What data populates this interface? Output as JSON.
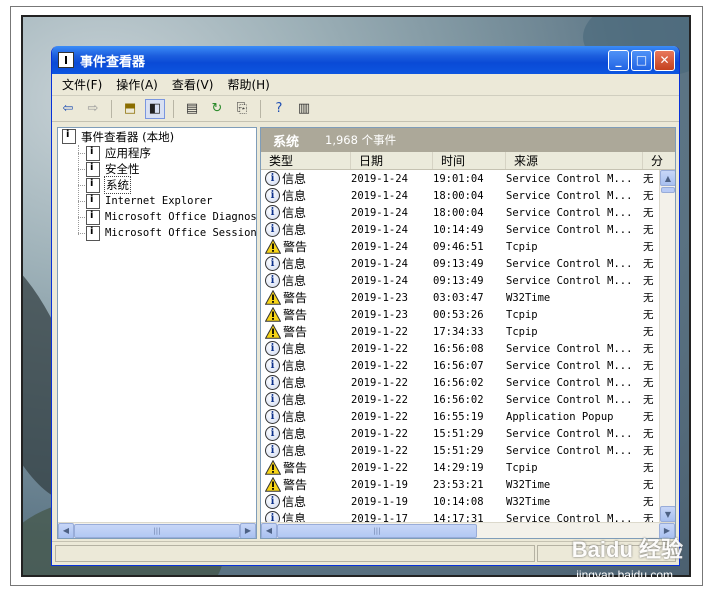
{
  "window": {
    "title": "事件查看器",
    "menu": [
      "文件(F)",
      "操作(A)",
      "查看(V)",
      "帮助(H)"
    ]
  },
  "tree": {
    "root": "事件查看器 (本地)",
    "items": [
      "应用程序",
      "安全性",
      "系统",
      "Internet Explorer",
      "Microsoft Office Diagnostics",
      "Microsoft Office Sessions"
    ],
    "selected_index": 2
  },
  "list": {
    "header_name": "系统",
    "header_count": "1,968 个事件",
    "columns": [
      "类型",
      "日期",
      "时间",
      "来源",
      "分"
    ],
    "rows": [
      {
        "type": "info",
        "label": "信息",
        "date": "2019-1-24",
        "time": "19:01:04",
        "source": "Service Control M...",
        "cat": "无"
      },
      {
        "type": "info",
        "label": "信息",
        "date": "2019-1-24",
        "time": "18:00:04",
        "source": "Service Control M...",
        "cat": "无"
      },
      {
        "type": "info",
        "label": "信息",
        "date": "2019-1-24",
        "time": "18:00:04",
        "source": "Service Control M...",
        "cat": "无"
      },
      {
        "type": "info",
        "label": "信息",
        "date": "2019-1-24",
        "time": "10:14:49",
        "source": "Service Control M...",
        "cat": "无"
      },
      {
        "type": "warn",
        "label": "警告",
        "date": "2019-1-24",
        "time": "09:46:51",
        "source": "Tcpip",
        "cat": "无"
      },
      {
        "type": "info",
        "label": "信息",
        "date": "2019-1-24",
        "time": "09:13:49",
        "source": "Service Control M...",
        "cat": "无"
      },
      {
        "type": "info",
        "label": "信息",
        "date": "2019-1-24",
        "time": "09:13:49",
        "source": "Service Control M...",
        "cat": "无"
      },
      {
        "type": "warn",
        "label": "警告",
        "date": "2019-1-23",
        "time": "03:03:47",
        "source": "W32Time",
        "cat": "无"
      },
      {
        "type": "warn",
        "label": "警告",
        "date": "2019-1-23",
        "time": "00:53:26",
        "source": "Tcpip",
        "cat": "无"
      },
      {
        "type": "warn",
        "label": "警告",
        "date": "2019-1-22",
        "time": "17:34:33",
        "source": "Tcpip",
        "cat": "无"
      },
      {
        "type": "info",
        "label": "信息",
        "date": "2019-1-22",
        "time": "16:56:08",
        "source": "Service Control M...",
        "cat": "无"
      },
      {
        "type": "info",
        "label": "信息",
        "date": "2019-1-22",
        "time": "16:56:07",
        "source": "Service Control M...",
        "cat": "无"
      },
      {
        "type": "info",
        "label": "信息",
        "date": "2019-1-22",
        "time": "16:56:02",
        "source": "Service Control M...",
        "cat": "无"
      },
      {
        "type": "info",
        "label": "信息",
        "date": "2019-1-22",
        "time": "16:56:02",
        "source": "Service Control M...",
        "cat": "无"
      },
      {
        "type": "info",
        "label": "信息",
        "date": "2019-1-22",
        "time": "16:55:19",
        "source": "Application Popup",
        "cat": "无"
      },
      {
        "type": "info",
        "label": "信息",
        "date": "2019-1-22",
        "time": "15:51:29",
        "source": "Service Control M...",
        "cat": "无"
      },
      {
        "type": "info",
        "label": "信息",
        "date": "2019-1-22",
        "time": "15:51:29",
        "source": "Service Control M...",
        "cat": "无"
      },
      {
        "type": "warn",
        "label": "警告",
        "date": "2019-1-22",
        "time": "14:29:19",
        "source": "Tcpip",
        "cat": "无"
      },
      {
        "type": "warn",
        "label": "警告",
        "date": "2019-1-19",
        "time": "23:53:21",
        "source": "W32Time",
        "cat": "无"
      },
      {
        "type": "info",
        "label": "信息",
        "date": "2019-1-19",
        "time": "10:14:08",
        "source": "W32Time",
        "cat": "无"
      },
      {
        "type": "info",
        "label": "信息",
        "date": "2019-1-17",
        "time": "14:17:31",
        "source": "Service Control M...",
        "cat": "无"
      }
    ]
  },
  "icons": {
    "back": "back-arrow-icon",
    "forward": "forward-arrow-icon",
    "up": "up-folder-icon",
    "tree_toggle": "show-hide-tree-icon",
    "properties": "properties-icon",
    "refresh": "refresh-icon",
    "export": "export-list-icon",
    "help": "help-icon",
    "console": "console-tree-icon"
  },
  "colors": {
    "titlebar": "#0a4ad6",
    "window_bg": "#ece9d8",
    "pane_header": "#aca899",
    "warning": "#f5d100"
  },
  "watermark": {
    "logo": "Baidu 经验",
    "url": "jingyan.baidu.com"
  }
}
